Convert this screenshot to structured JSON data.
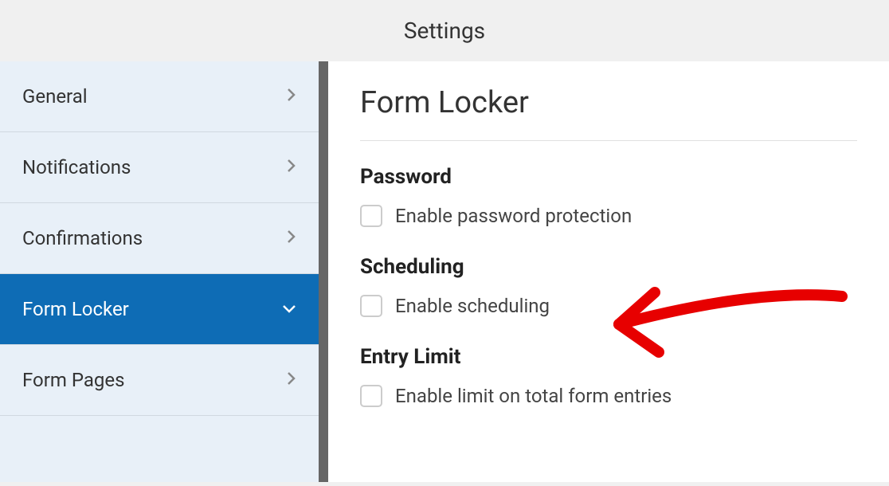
{
  "header": {
    "title": "Settings"
  },
  "sidebar": {
    "items": [
      {
        "label": "General"
      },
      {
        "label": "Notifications"
      },
      {
        "label": "Confirmations"
      },
      {
        "label": "Form Locker"
      },
      {
        "label": "Form Pages"
      }
    ]
  },
  "content": {
    "page_title": "Form Locker",
    "sections": {
      "password": {
        "heading": "Password",
        "checkbox_label": "Enable password protection"
      },
      "scheduling": {
        "heading": "Scheduling",
        "checkbox_label": "Enable scheduling"
      },
      "entry_limit": {
        "heading": "Entry Limit",
        "checkbox_label": "Enable limit on total form entries"
      }
    }
  }
}
